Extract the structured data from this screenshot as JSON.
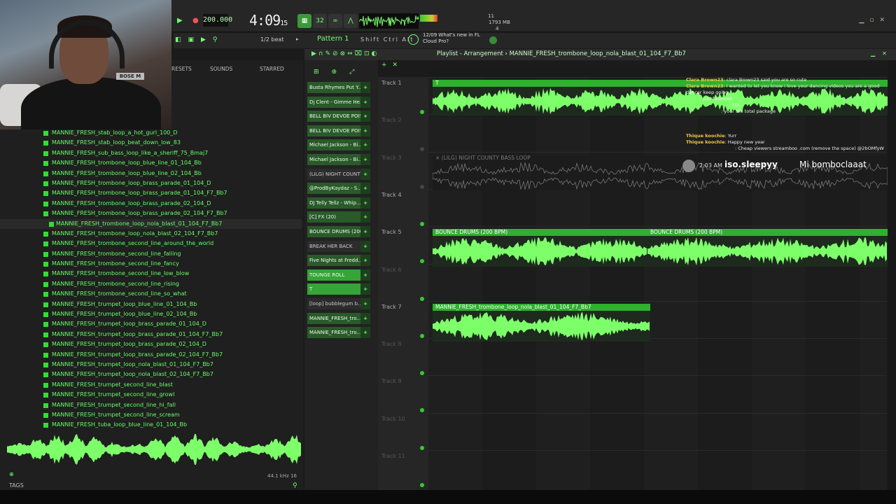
{
  "toolbar": {
    "tempo": "200.000",
    "time_main": "4:09",
    "time_sub": "15",
    "cpu_line1": "11",
    "cpu_line2": "1793 MB",
    "cpu_line3": "4",
    "beat_label": "1/2 beat",
    "pattern_label": "Pattern 1",
    "modifiers": "Shift  Ctrl  Alt",
    "news_line1": "12/09  What's new in FL",
    "news_line2": "Cloud Pro?"
  },
  "browser": {
    "tab_presets": "RESETS",
    "tab_sounds": "SOUNDS",
    "tab_starred": "STARRED",
    "files": [
      "MANNIE_FRESH_stab_loop_a_hot_gurl_100_D",
      "MANNIE_FRESH_stab_loop_beat_down_low_83",
      "MANNIE_FRESH_sub_bass_loop_like_a_sheriff_75_Bmaj7",
      "MANNIE_FRESH_trombone_loop_blue_line_01_104_Bb",
      "MANNIE_FRESH_trombone_loop_blue_line_02_104_Bb",
      "MANNIE_FRESH_trombone_loop_brass_parade_01_104_D",
      "MANNIE_FRESH_trombone_loop_brass_parade_01_104_F7_Bb7",
      "MANNIE_FRESH_trombone_loop_brass_parade_02_104_D",
      "MANNIE_FRESH_trombone_loop_brass_parade_02_104_F7_Bb7",
      "MANNIE_FRESH_trombone_loop_nola_blast_01_104_F7_Bb7",
      "MANNIE_FRESH_trombone_loop_nola_blast_02_104_F7_Bb7",
      "MANNIE_FRESH_trombone_second_line_around_the_world",
      "MANNIE_FRESH_trombone_second_line_falling",
      "MANNIE_FRESH_trombone_second_line_fancy",
      "MANNIE_FRESH_trombone_second_line_low_blow",
      "MANNIE_FRESH_trombone_second_line_rising",
      "MANNIE_FRESH_trombone_second_line_so_what",
      "MANNIE_FRESH_trumpet_loop_blue_line_01_104_Bb",
      "MANNIE_FRESH_trumpet_loop_blue_line_02_104_Bb",
      "MANNIE_FRESH_trumpet_loop_brass_parade_01_104_D",
      "MANNIE_FRESH_trumpet_loop_brass_parade_01_104_F7_Bb7",
      "MANNIE_FRESH_trumpet_loop_brass_parade_02_104_D",
      "MANNIE_FRESH_trumpet_loop_brass_parade_02_104_F7_Bb7",
      "MANNIE_FRESH_trumpet_loop_nola_blast_01_104_F7_Bb7",
      "MANNIE_FRESH_trumpet_loop_nola_blast_02_104_F7_Bb7",
      "MANNIE_FRESH_trumpet_second_line_blast",
      "MANNIE_FRESH_trumpet_second_line_growl",
      "MANNIE_FRESH_trumpet_second_line_hi_fall",
      "MANNIE_FRESH_trumpet_second_line_scream",
      "MANNIE_FRESH_tuba_loop_blue_line_01_104_Bb"
    ],
    "selected_index": 9,
    "sample_info": "44.1 kHz 16",
    "tags_label": "TAGS"
  },
  "channels": [
    "Busta Rhymes  Put Y...",
    "Dj Clent - Gimme He...",
    "BELL BIV DEVOE POIS...",
    "BELL BIV DEVOE POIS...",
    "Michael Jackson - Bi...",
    "Michael Jackson - Bi...",
    "(LILG) NIGHT COUNTY...",
    "@ProdByKaydaz - S...",
    "DJ Telly Tellz - Whip...",
    "[C] FX (20)",
    "BOUNCE DRUMS (200...",
    "BREAK HER BACK",
    "Five Nights at Fredd...",
    "TOUNGE ROLL",
    "T",
    "[loop] bubblegum b...",
    "MANNIE_FRESH_tro...",
    "MANNIE_FRESH_tro..."
  ],
  "playlist": {
    "title": "Playlist - Arrangement › MANNIE_FRESH_trombone_loop_nola_blast_01_104_F7_Bb7",
    "tracks": [
      "Track 1",
      "Track 2",
      "Track 3",
      "Track 4",
      "Track 5",
      "Track 6",
      "Track 7",
      "Track 8",
      "Track 9",
      "Track 10",
      "Track 11"
    ],
    "clip_track3": "× (LILG) NIGHT COUNTY BASS LOOP",
    "clip_track5a": "BOUNCE DRUMS (200 BPM)",
    "clip_track5b": "BOUNCE DRUMS (200 BPM)",
    "clip_track7": "MANNIE_FRESH_trombone_loop_nola_blast_01_104_F7_Bb7"
  },
  "chat": {
    "l1_user": "Clara Brown23",
    "l1_msg": ": clara Brown23 said you are so cute",
    "l2_user": "Clara Brown23",
    "l2_msg": ": i wanted to let you know i love your dancing videos you are a good dancer keep going",
    "l3_msg": "just followed",
    "l4_msg": ": LOL",
    "l5_msg": ": your the total package",
    "l6_user": "Thique koochie",
    "l6_msg": ": Yurr",
    "l7_user": "Thique koochie",
    "l7_msg": ": Happy new year",
    "l8_msg": ": Cheap viewers streamboo .com (remove the space) @2bOMfyW",
    "alert_time": "2:03 AM",
    "alert_name": "iso.sleepyy",
    "alert_msg": "Mi bomboclaaat"
  },
  "webcam_text": "BOSE M",
  "colors": {
    "accent": "#2fb02f",
    "wave": "#7dff6a",
    "bg": "#1b1b1b"
  }
}
